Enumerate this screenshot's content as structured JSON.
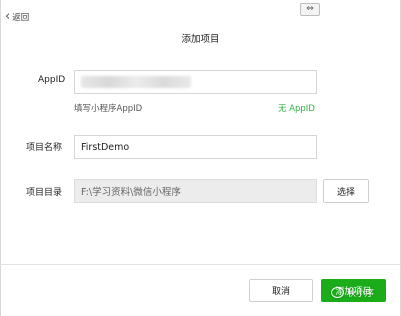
{
  "nav": {
    "back_label": "返回"
  },
  "toolbar": {
    "toggle_glyph": "⇔"
  },
  "dialog": {
    "title": "添加项目",
    "appid": {
      "label": "AppID",
      "hint": "填写小程序AppID",
      "no_appid_link": "无 AppID"
    },
    "project_name": {
      "label": "项目名称",
      "value": "FirstDemo"
    },
    "project_dir": {
      "label": "项目目录",
      "value": "F:\\学习资料\\微信小程序",
      "choose_label": "选择"
    },
    "footer": {
      "cancel_label": "取消",
      "add_label": "添加项目"
    }
  },
  "watermark": {
    "text": "秋小序"
  },
  "colors": {
    "accent_green": "#1aad19",
    "link_green": "#2db540"
  }
}
